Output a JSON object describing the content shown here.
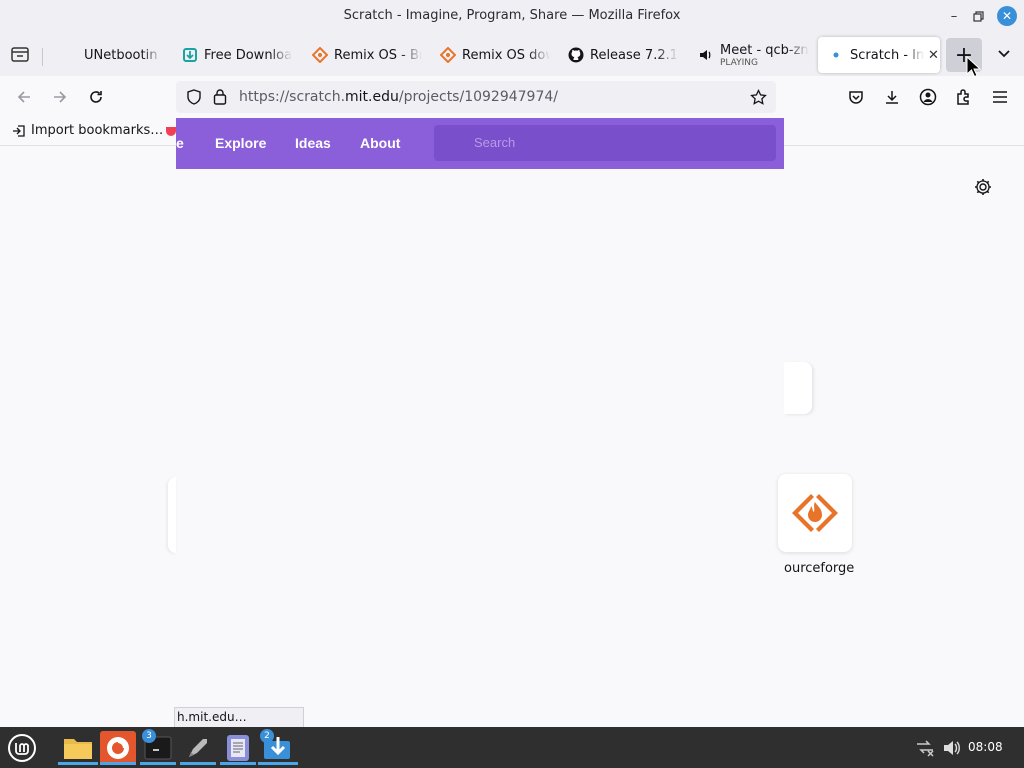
{
  "window": {
    "title": "Scratch - Imagine, Program, Share — Mozilla Firefox"
  },
  "tabs": [
    {
      "label": "UNetbootin - I"
    },
    {
      "label": "Free Downloa"
    },
    {
      "label": "Remix OS - Br"
    },
    {
      "label": "Remix OS dow"
    },
    {
      "label": "Release 7.2.1"
    },
    {
      "label": "Meet - qcb-zn",
      "sub": "PLAYING"
    },
    {
      "label": "Scratch - Im"
    }
  ],
  "newtab": {
    "label": "+"
  },
  "navbar": {
    "url_prefix": "https://scratch.",
    "url_host": "mit.edu",
    "url_suffix": "/projects/1092947974/"
  },
  "bookmarks": {
    "import": "Import bookmarks…"
  },
  "scratch": {
    "nav_cut": "e",
    "explore": "Explore",
    "ideas": "Ideas",
    "about": "About",
    "search_placeholder": "Search"
  },
  "shortcut": {
    "label": "ourceforge"
  },
  "status_tip": "h.mit.edu…",
  "taskbar": {
    "terminal_badge": "3",
    "updates_badge": "2",
    "clock": "08:08"
  },
  "colors": {
    "scratch_purple": "#8b5fd9",
    "sourceforge_orange": "#e8742a",
    "taskbar_bg": "#2f2f2f",
    "accent": "#3a8fd9"
  }
}
